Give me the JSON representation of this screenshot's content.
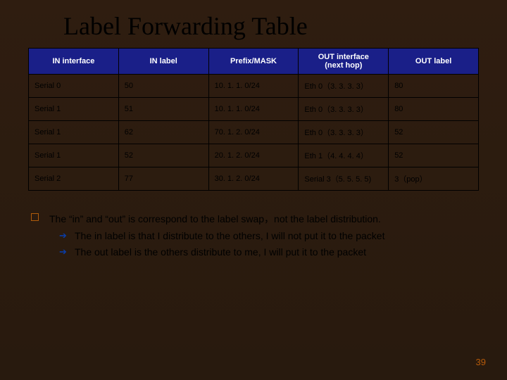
{
  "slide": {
    "title": "Label Forwarding Table",
    "page_number": "39"
  },
  "table": {
    "headers": {
      "c0": "IN interface",
      "c1": "IN label",
      "c2": "Prefix/MASK",
      "c3": "OUT interface\n(next hop)",
      "c4": "OUT label"
    },
    "rows": [
      {
        "c0": "Serial 0",
        "c1": "50",
        "c2": "10. 1. 1. 0/24",
        "c3": "Eth 0（3. 3. 3. 3）",
        "c4": "80"
      },
      {
        "c0": "Serial 1",
        "c1": "51",
        "c2": "10. 1. 1. 0/24",
        "c3": "Eth 0（3. 3. 3. 3）",
        "c4": "80"
      },
      {
        "c0": "Serial 1",
        "c1": "62",
        "c2": "70. 1. 2. 0/24",
        "c3": "Eth 0（3. 3. 3. 3）",
        "c4": "52"
      },
      {
        "c0": "Serial 1",
        "c1": "52",
        "c2": "20. 1. 2. 0/24",
        "c3": "Eth 1（4. 4. 4. 4）",
        "c4": "52"
      },
      {
        "c0": "Serial 2",
        "c1": "77",
        "c2": "30. 1. 2. 0/24",
        "c3": "Serial 3（5. 5. 5. 5)",
        "c4": "3（pop）"
      }
    ]
  },
  "notes": {
    "bullet": "The “in” and “out” is correspond to the label swap，not the label distribution.",
    "sub1": "The in label is that I distribute to the others, I will not put it to the packet",
    "sub2": "The out label is the others distribute to me, I will put it to the packet"
  }
}
